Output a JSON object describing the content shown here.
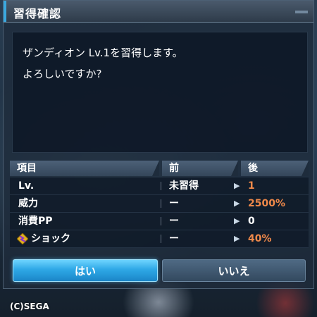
{
  "dialog": {
    "title": "習得確認",
    "message_lines": [
      "ザンディオン Lv.1を習得します。",
      "よろしいですか?"
    ]
  },
  "table": {
    "headers": {
      "item": "項目",
      "before": "前",
      "after": "後"
    },
    "rows": [
      {
        "item": "Lv.",
        "before": "未習得",
        "arrow": "▶",
        "after": "1",
        "after_color": "#f0894a"
      },
      {
        "item": "威力",
        "before": "ー",
        "arrow": "▶",
        "after": "2500%",
        "after_color": "#f0894a"
      },
      {
        "item": "消費PP",
        "before": "ー",
        "arrow": "▶",
        "after": "0",
        "after_color": "#ffffff"
      },
      {
        "item": "ショック",
        "before": "ー",
        "arrow": "▶",
        "after": "40%",
        "after_color": "#f0894a",
        "icon": "shock-status-icon"
      }
    ]
  },
  "buttons": {
    "yes": "はい",
    "no": "いいえ"
  },
  "copyright": "(C)SEGA",
  "colors": {
    "accent": "#3aa9e0",
    "value_highlight": "#f0894a",
    "button_active": "#2ea8e6"
  }
}
